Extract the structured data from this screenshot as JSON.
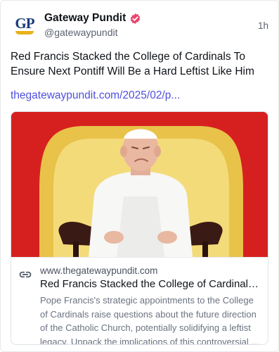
{
  "post": {
    "author": {
      "display_name": "Gateway Pundit",
      "handle": "@gatewaypundit",
      "avatar_text": "GP",
      "avatar_icon": "gateway-pundit-logo",
      "verified": true
    },
    "timestamp": "1h",
    "text": "Red Francis Stacked the College of Cardinals To Ensure Next Pontiff Will Be a Hard Leftist Like Him",
    "link_text": "thegatewaypundit.com/2025/02/p...",
    "colors": {
      "link": "#4f4fdd",
      "verified_badge": "#e5486f",
      "image_background": "#d6201f"
    }
  },
  "link_card": {
    "icon": "link-icon",
    "domain": "www.thegatewaypundit.com",
    "title": "Red Francis Stacked the College of Cardinals T...",
    "description": "Pope Francis's strategic appointments to the College of Cardinals raise questions about the future direction of the Catholic Church, potentially solidifying a leftist legacy. Unpack the implications of this controversial ...",
    "image_icon": "pope-photo"
  }
}
